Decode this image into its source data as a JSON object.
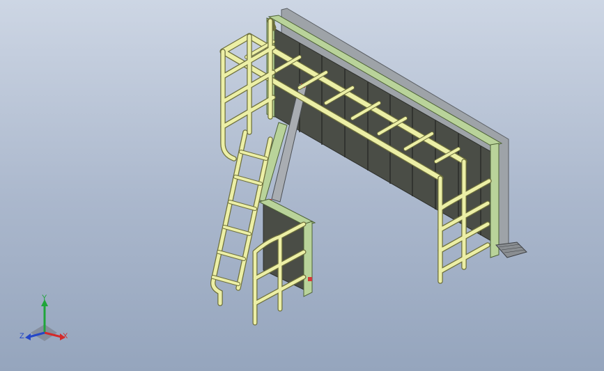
{
  "viewport": {
    "background_top": "#cdd6e4",
    "background_bottom": "#95a5bd"
  },
  "model": {
    "colors": {
      "railing": "#ecefa6",
      "railing_edge": "#6d6f3c",
      "panel": "#4a4d46",
      "panel_dark": "#3a3d36",
      "frame": "#b9d39a",
      "frame_edge": "#4c6035",
      "metal": "#a9adb2",
      "marker": "#d23a3a"
    }
  },
  "triad": {
    "x_label": "X",
    "y_label": "Y",
    "z_label": "Z",
    "x_color": "#d42a2a",
    "y_color": "#1fa53a",
    "z_color": "#2447c8"
  }
}
